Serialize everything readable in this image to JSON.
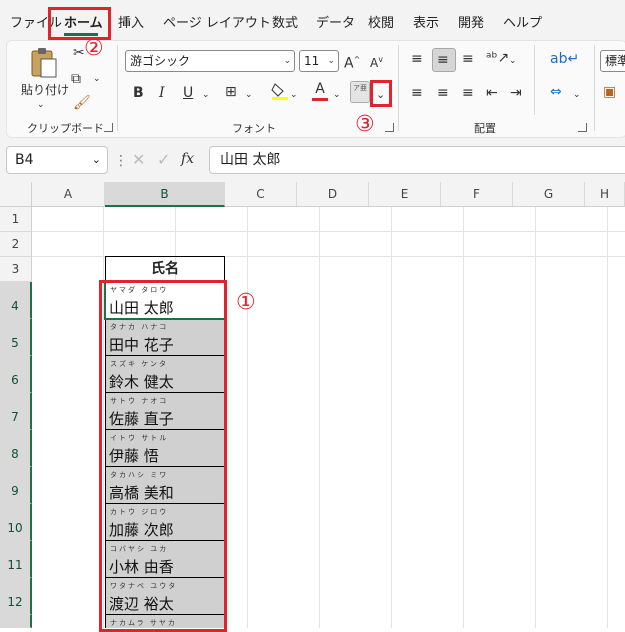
{
  "menu": {
    "tabs": [
      "ファイル",
      "ホーム",
      "挿入",
      "ページ レイアウト",
      "数式",
      "データ",
      "校閲",
      "表示",
      "開発",
      "ヘルプ"
    ],
    "active_tab": "ホーム"
  },
  "ribbon": {
    "clipboard": {
      "paste_label": "貼り付け",
      "group_label": "クリップボード"
    },
    "font": {
      "font_name": "游ゴシック",
      "font_size": "11",
      "group_label": "フォント",
      "bold": "B",
      "italic": "I",
      "underline": "U",
      "font_color_letter": "A",
      "phonetic_glyph": "ア亜"
    },
    "alignment": {
      "group_label": "配置"
    },
    "number": {
      "format": "標準"
    }
  },
  "formula_bar": {
    "name_box": "B4",
    "fx_label": "fx",
    "value": "山田 太郎"
  },
  "columns": [
    "A",
    "B",
    "C",
    "D",
    "E",
    "F",
    "G",
    "H"
  ],
  "rows": [
    "1",
    "2",
    "3",
    "4",
    "5",
    "6",
    "7",
    "8",
    "9",
    "10",
    "11",
    "12"
  ],
  "table": {
    "header": "氏名",
    "entries": [
      {
        "furigana": "ヤマダ タロウ",
        "name": "山田 太郎"
      },
      {
        "furigana": "タナカ ハナコ",
        "name": "田中 花子"
      },
      {
        "furigana": "スズキ ケンタ",
        "name": "鈴木 健太"
      },
      {
        "furigana": "サトウ ナオコ",
        "name": "佐藤 直子"
      },
      {
        "furigana": "イトウ サトル",
        "name": "伊藤 悟"
      },
      {
        "furigana": "タカハシ ミワ",
        "name": "高橋 美和"
      },
      {
        "furigana": "カトウ ジロウ",
        "name": "加藤 次郎"
      },
      {
        "furigana": "コバヤシ ユカ",
        "name": "小林 由香"
      },
      {
        "furigana": "ワタナベ ユウタ",
        "name": "渡辺 裕太"
      },
      {
        "furigana": "ナカムラ サヤカ",
        "name": ""
      }
    ]
  },
  "annotations": [
    "①",
    "②",
    "③"
  ],
  "colors": {
    "accent_green": "#1e7145",
    "marker_red": "#e0232c",
    "selection_grey": "#d0d0d0"
  }
}
